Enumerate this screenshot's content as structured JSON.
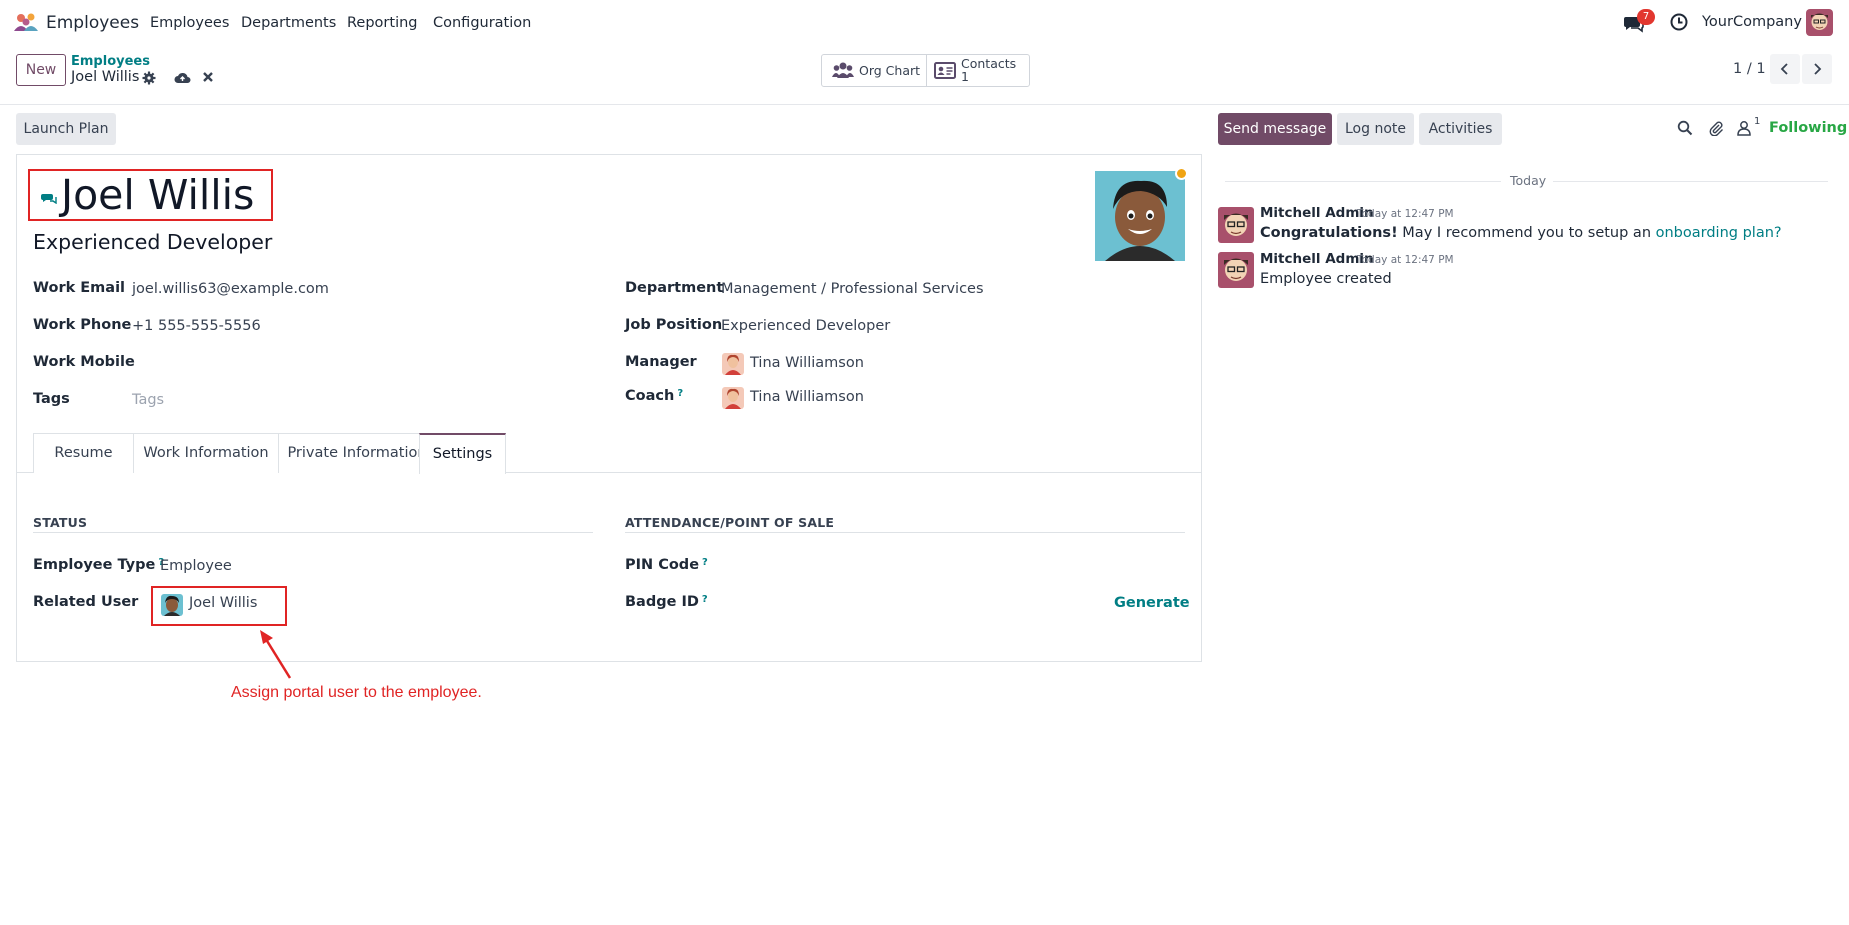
{
  "navbar": {
    "app_name": "Employees",
    "menu": [
      "Employees",
      "Departments",
      "Reporting",
      "Configuration"
    ],
    "messages_badge": "7",
    "company": "YourCompany"
  },
  "control_panel": {
    "new_label": "New",
    "breadcrumb_parent": "Employees",
    "breadcrumb_current": "Joel Willis",
    "stat_org_chart": "Org Chart",
    "stat_contacts_label": "Contacts",
    "stat_contacts_value": "1",
    "pager": "1 / 1"
  },
  "form": {
    "launch_plan": "Launch Plan",
    "name": "Joel Willis",
    "job_title": "Experienced Developer",
    "left_fields": [
      {
        "label": "Work Email",
        "value": "joel.willis63@example.com"
      },
      {
        "label": "Work Phone",
        "value": "+1 555-555-5556"
      },
      {
        "label": "Work Mobile",
        "value": ""
      },
      {
        "label": "Tags",
        "placeholder": "Tags"
      }
    ],
    "right_fields": [
      {
        "label": "Department",
        "value": "Management / Professional Services"
      },
      {
        "label": "Job Position",
        "value": "Experienced Developer"
      },
      {
        "label": "Manager",
        "value": "Tina Williamson"
      },
      {
        "label": "Coach",
        "value": "Tina Williamson"
      }
    ],
    "help_mark": "?",
    "tabs": [
      "Resume",
      "Work Information",
      "Private Information",
      "Settings"
    ],
    "active_tab": "Settings",
    "status_section": "STATUS",
    "attendance_section": "ATTENDANCE/POINT OF SALE",
    "employee_type_label": "Employee Type",
    "employee_type_value": "Employee",
    "related_user_label": "Related User",
    "related_user_value": "Joel Willis",
    "pin_code_label": "PIN Code",
    "badge_id_label": "Badge ID",
    "generate_label": "Generate"
  },
  "annotation": {
    "text": "Assign portal user to the employee.",
    "color": "#e02424"
  },
  "chatter": {
    "send_message": "Send message",
    "log_note": "Log note",
    "activities": "Activities",
    "followers_count": "1",
    "following": "Following",
    "date_separator": "Today",
    "messages": [
      {
        "author": "Mitchell Admin",
        "time": "Today at 12:47 PM",
        "bold": "Congratulations!",
        "text": " May I recommend you to setup an ",
        "link": "onboarding plan?"
      },
      {
        "author": "Mitchell Admin",
        "time": "Today at 12:47 PM",
        "text": "Employee created"
      }
    ]
  },
  "colors": {
    "brand": "#714b67",
    "link": "#017e84",
    "following": "#28a745",
    "highlight": "#e02424"
  }
}
